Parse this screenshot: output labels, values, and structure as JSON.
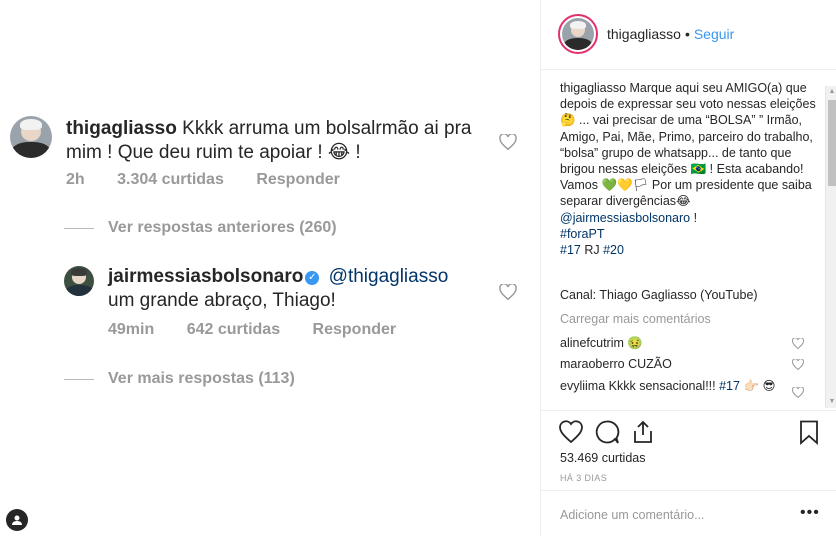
{
  "media": {
    "comment1": {
      "username": "thigagliasso",
      "text": "Kkkk arruma um bolsalrmão ai pra mim ! Que deu ruim te apoiar ! 😂 !",
      "time": "2h",
      "likes": "3.304 curtidas",
      "reply": "Responder"
    },
    "previous_replies": "Ver respostas anteriores (260)",
    "reply1": {
      "username": "jairmessiasbolsonaro",
      "mention": "@thigagliasso",
      "text": "um grande abraço, Thiago!",
      "time": "49min",
      "likes": "642 curtidas",
      "reply": "Responder"
    },
    "more_replies": "Ver mais respostas (113)"
  },
  "header": {
    "username": "thigagliasso",
    "separator": "•",
    "follow_label": "Seguir"
  },
  "caption": {
    "username": "thigagliasso",
    "text_part1": " Marque aqui seu AMIGO(a) que depois de expressar seu voto nessas eleições 🤔 ... vai precisar de uma “BOLSA” ” Irmão, Amigo, Pai, Mãe, Primo, parceiro do trabalho, “bolsa” grupo de whatsapp... de tanto que brigou nessas eleições 🇧🇷 ! Esta acabando! Vamos 💚💛🏳 Por um presidente que saiba separar divergências😂 ",
    "mention": "@jairmessiasbolsonaro",
    "text_part2": " !",
    "hashtag1": "#foraPT",
    "hashtag2": "#17",
    "text_part3": " RJ ",
    "hashtag3": "#20",
    "channel": "Canal: Thiago Gagliasso (YouTube)"
  },
  "load_more": "Carregar mais comentários",
  "comments": [
    {
      "username": "alinefcutrim",
      "text": " 🤢"
    },
    {
      "username": "maraoberro",
      "text": " CUZÃO"
    },
    {
      "username": "evyliima",
      "text": " Kkkk sensacional!!! ",
      "hashtag": "#17",
      "text2": " 👉🏻 😎"
    }
  ],
  "actions": {
    "likes": "53.469 curtidas",
    "date": "HÁ 3 DIAS",
    "icons": [
      "heart-icon",
      "comment-icon",
      "share-icon",
      "bookmark-icon"
    ]
  },
  "add_comment": {
    "placeholder": "Adicione um comentário...",
    "more": "•••"
  },
  "colors": {
    "link": "#003569",
    "follow": "#3897f0",
    "muted": "#999999",
    "text": "#262626"
  }
}
